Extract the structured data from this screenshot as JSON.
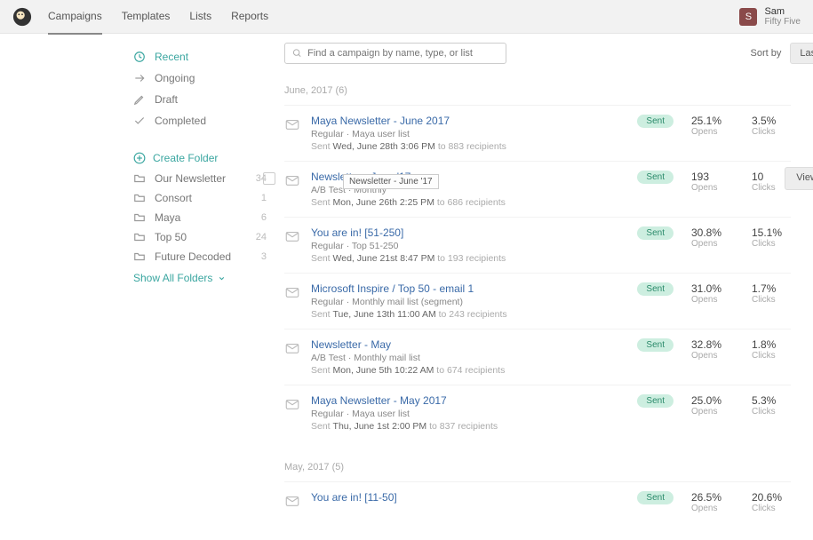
{
  "nav": {
    "tabs": [
      "Campaigns",
      "Templates",
      "Lists",
      "Reports"
    ],
    "active": 0
  },
  "user": {
    "initial": "S",
    "name": "Sam",
    "org": "Fifty Five"
  },
  "sidebar": {
    "quick": [
      {
        "label": "Recent",
        "icon": "clock",
        "active": true
      },
      {
        "label": "Ongoing",
        "icon": "arrow",
        "active": false
      },
      {
        "label": "Draft",
        "icon": "pencil",
        "active": false
      },
      {
        "label": "Completed",
        "icon": "check",
        "active": false
      }
    ],
    "create_folder": "Create Folder",
    "folders": [
      {
        "label": "Our Newsletter",
        "count": 34
      },
      {
        "label": "Consort",
        "count": 1
      },
      {
        "label": "Maya",
        "count": 6
      },
      {
        "label": "Top 50",
        "count": 24
      },
      {
        "label": "Future Decoded",
        "count": 3
      }
    ],
    "show_all": "Show All Folders"
  },
  "search": {
    "placeholder": "Find a campaign by name, type, or list"
  },
  "sort": {
    "label": "Sort by",
    "value": "Last updated"
  },
  "groups": [
    {
      "header": "June, 2017 (6)",
      "rows": [
        {
          "title": "Maya Newsletter - June 2017",
          "meta": "Regular · Maya user list",
          "sent_prefix": "Sent ",
          "sent_bold": "Wed, June 28th 3:06 PM",
          "sent_suffix": " to 883 recipients",
          "status": "Sent",
          "opens": "25.1%",
          "clicks": "3.5%",
          "checked": false,
          "hovered": false
        },
        {
          "title": "Newsletter - June '17",
          "meta": "A/B Test · Monthly",
          "sent_prefix": "Sent ",
          "sent_bold": "Mon, June 26th 2:25 PM",
          "sent_suffix": " to 686 recipients",
          "status": "Sent",
          "opens": "193",
          "clicks": "10",
          "checked": false,
          "hovered": true,
          "tooltip": "Newsletter - June '17",
          "action_label": "View Report"
        },
        {
          "title": "You are in! [51-250]",
          "meta": "Regular · Top 51-250",
          "sent_prefix": "Sent ",
          "sent_bold": "Wed, June 21st 8:47 PM",
          "sent_suffix": " to 193 recipients",
          "status": "Sent",
          "opens": "30.8%",
          "clicks": "15.1%",
          "checked": false,
          "hovered": false
        },
        {
          "title": "Microsoft Inspire / Top 50 - email 1",
          "meta": "Regular · Monthly mail list (segment)",
          "sent_prefix": "Sent ",
          "sent_bold": "Tue, June 13th 11:00 AM",
          "sent_suffix": " to 243 recipients",
          "status": "Sent",
          "opens": "31.0%",
          "clicks": "1.7%",
          "checked": false,
          "hovered": false
        },
        {
          "title": "Newsletter - May",
          "meta": "A/B Test · Monthly mail list",
          "sent_prefix": "Sent ",
          "sent_bold": "Mon, June 5th 10:22 AM",
          "sent_suffix": " to 674 recipients",
          "status": "Sent",
          "opens": "32.8%",
          "clicks": "1.8%",
          "checked": false,
          "hovered": false
        },
        {
          "title": "Maya Newsletter - May 2017",
          "meta": "Regular · Maya user list",
          "sent_prefix": "Sent ",
          "sent_bold": "Thu, June 1st 2:00 PM",
          "sent_suffix": " to 837 recipients",
          "status": "Sent",
          "opens": "25.0%",
          "clicks": "5.3%",
          "checked": false,
          "hovered": false
        }
      ]
    },
    {
      "header": "May, 2017 (5)",
      "rows": [
        {
          "title": "You are in! [11-50]",
          "meta": "",
          "sent_prefix": "",
          "sent_bold": "",
          "sent_suffix": "",
          "status": "Sent",
          "opens": "26.5%",
          "clicks": "20.6%",
          "checked": false,
          "hovered": false
        }
      ]
    }
  ],
  "labels": {
    "opens": "Opens",
    "clicks": "Clicks"
  }
}
